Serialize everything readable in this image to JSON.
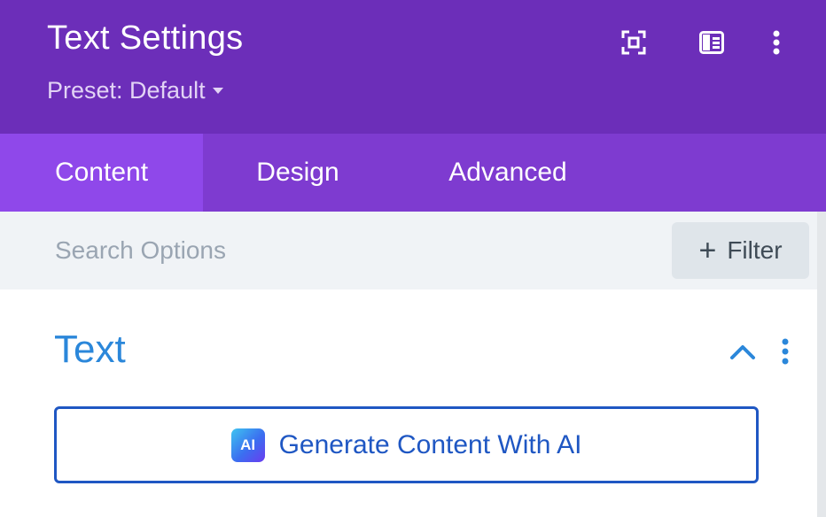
{
  "header": {
    "title": "Text Settings",
    "preset_label": "Preset: Default",
    "icons": [
      "expand-icon",
      "sidebar-layout-icon",
      "more-vertical-icon"
    ]
  },
  "tabs": [
    {
      "label": "Content",
      "active": true
    },
    {
      "label": "Design",
      "active": false
    },
    {
      "label": "Advanced",
      "active": false
    }
  ],
  "search": {
    "placeholder": "Search Options",
    "value": "",
    "filter_label": "Filter"
  },
  "section": {
    "title": "Text",
    "collapsed": false,
    "ai_button_label": "Generate Content With AI",
    "ai_badge": "AI"
  },
  "colors": {
    "header_bg": "#6c2eb9",
    "tabs_bg": "#7e3bd0",
    "active_tab_bg": "#8f48ea",
    "accent_blue": "#2b87da",
    "ai_button_blue": "#1f57c3"
  }
}
